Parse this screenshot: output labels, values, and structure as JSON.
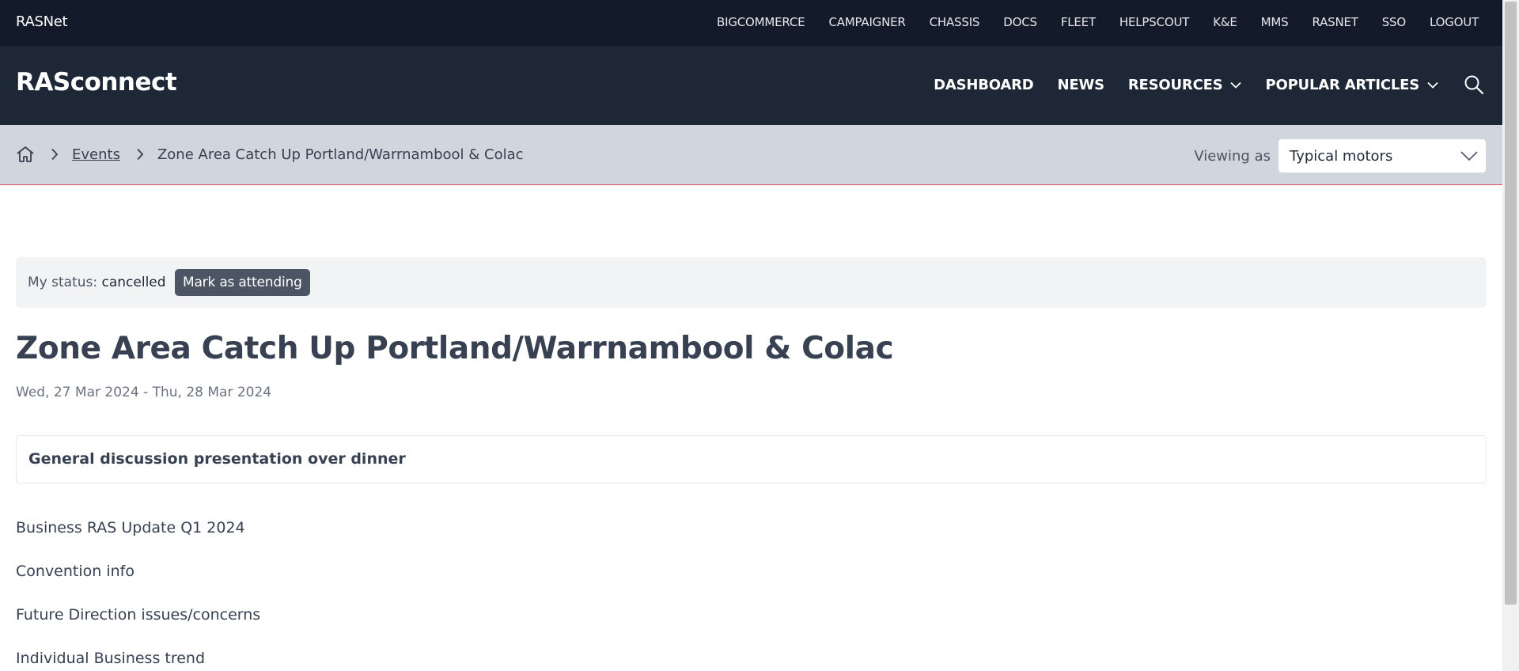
{
  "topbar": {
    "brand": "RASNet",
    "links": [
      "BIGCOMMERCE",
      "CAMPAIGNER",
      "CHASSIS",
      "DOCS",
      "FLEET",
      "HELPSCOUT",
      "K&E",
      "MMS",
      "RASNET",
      "SSO",
      "LOGOUT"
    ]
  },
  "mainnav": {
    "logo": "RASconnect",
    "items": [
      {
        "label": "DASHBOARD",
        "icon": ""
      },
      {
        "label": "NEWS",
        "icon": ""
      },
      {
        "label": "RESOURCES",
        "icon": "chevron-down-icon"
      },
      {
        "label": "POPULAR ARTICLES",
        "icon": "chevron-down-icon"
      }
    ],
    "search_icon": "search-icon"
  },
  "breadcrumb": {
    "home_icon": "home-icon",
    "items": [
      "Events",
      "Zone Area Catch Up Portland/Warrnambool & Colac"
    ]
  },
  "viewing": {
    "label": "Viewing as",
    "selected": "Typical motors"
  },
  "status": {
    "label": "My status:",
    "value": "cancelled",
    "button": "Mark as attending"
  },
  "event": {
    "title": "Zone Area Catch Up Portland/Warrnambool & Colac",
    "dates": "Wed, 27 Mar 2024 - Thu, 28 Mar 2024",
    "card_heading": "General discussion presentation over dinner",
    "agenda": [
      "Business RAS Update Q1 2024",
      "Convention info",
      "Future Direction issues/concerns",
      "Individual Business trend"
    ]
  },
  "colors": {
    "topbar_bg": "#131b2b",
    "nav_bg": "#1e2736",
    "crumb_bg": "#d1d5dd",
    "accent_line": "#dc5060",
    "button_bg": "#4b5563"
  }
}
